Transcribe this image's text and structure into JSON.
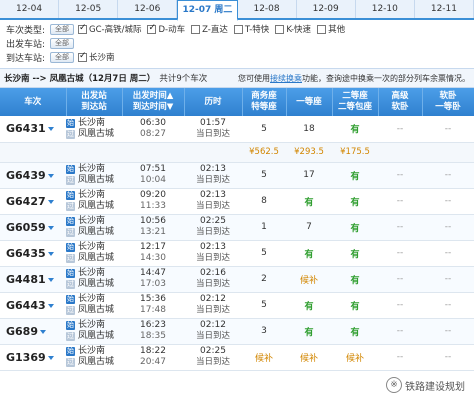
{
  "date_tabs": [
    {
      "label": "12-04",
      "active": false
    },
    {
      "label": "12-05",
      "active": false
    },
    {
      "label": "12-06",
      "active": false
    },
    {
      "label": "12-07 周二",
      "active": true
    },
    {
      "label": "12-08",
      "active": false
    },
    {
      "label": "12-09",
      "active": false
    },
    {
      "label": "12-10",
      "active": false
    },
    {
      "label": "12-11",
      "active": false
    }
  ],
  "filters": {
    "train_type_label": "车次类型:",
    "depart_station_label": "出发车站:",
    "arrive_station_label": "到达车站:",
    "all_label": "全部",
    "train_types": [
      {
        "label": "GC-高铁/城际",
        "checked": true
      },
      {
        "label": "D-动车",
        "checked": true
      },
      {
        "label": "Z-直达",
        "checked": false
      },
      {
        "label": "T-特快",
        "checked": false
      },
      {
        "label": "K-快速",
        "checked": false
      },
      {
        "label": "其他",
        "checked": false
      }
    ],
    "depart_stations": [
      {
        "label": "长沙南",
        "checked": true
      }
    ]
  },
  "summary": {
    "route": "长沙南 --> 凤凰古城（12月7日 周二）",
    "count": "共计9个车次",
    "tip_prefix": "您可使用",
    "tip_link": "接续换乘",
    "tip_suffix": "功能，查询途中换乘一次的部分列车余票情况。"
  },
  "table": {
    "headers": [
      "车次",
      "出发站\n到达站",
      "出发时间▲\n到达时间▼",
      "历时",
      "商务座\n特等座",
      "一等座",
      "二等座\n二等包座",
      "高级\n软卧",
      "软卧\n一等卧"
    ],
    "rows": [
      {
        "train": "G6431",
        "from": "长沙南",
        "to": "凤凰古城",
        "dep": "06:30",
        "arr": "08:27",
        "dur": "01:57",
        "dur_sub": "当日到达",
        "business": "5",
        "first": "18",
        "second": "有",
        "adv_soft": "--",
        "soft": "--",
        "price": {
          "business": "¥562.5",
          "first": "¥293.5",
          "second": "¥175.5"
        }
      },
      {
        "train": "G6439",
        "from": "长沙南",
        "to": "凤凰古城",
        "dep": "07:51",
        "arr": "10:04",
        "dur": "02:13",
        "dur_sub": "当日到达",
        "business": "5",
        "first": "17",
        "second": "有",
        "adv_soft": "--",
        "soft": "--"
      },
      {
        "train": "G6427",
        "from": "长沙南",
        "to": "凤凰古城",
        "dep": "09:20",
        "arr": "11:33",
        "dur": "02:13",
        "dur_sub": "当日到达",
        "business": "8",
        "first": "有",
        "second": "有",
        "adv_soft": "--",
        "soft": "--"
      },
      {
        "train": "G6059",
        "from": "长沙南",
        "to": "凤凰古城",
        "dep": "10:56",
        "arr": "13:21",
        "dur": "02:25",
        "dur_sub": "当日到达",
        "business": "1",
        "first": "7",
        "second": "有",
        "adv_soft": "--",
        "soft": "--"
      },
      {
        "train": "G6435",
        "from": "长沙南",
        "to": "凤凰古城",
        "dep": "12:17",
        "arr": "14:30",
        "dur": "02:13",
        "dur_sub": "当日到达",
        "business": "5",
        "first": "有",
        "second": "有",
        "adv_soft": "--",
        "soft": "--"
      },
      {
        "train": "G4481",
        "from": "长沙南",
        "to": "凤凰古城",
        "dep": "14:47",
        "arr": "17:03",
        "dur": "02:16",
        "dur_sub": "当日到达",
        "business": "2",
        "first": "候补",
        "second": "有",
        "adv_soft": "--",
        "soft": "--"
      },
      {
        "train": "G6443",
        "from": "长沙南",
        "to": "凤凰古城",
        "dep": "15:36",
        "arr": "17:48",
        "dur": "02:12",
        "dur_sub": "当日到达",
        "business": "5",
        "first": "有",
        "second": "有",
        "adv_soft": "--",
        "soft": "--"
      },
      {
        "train": "G689",
        "from": "长沙南",
        "to": "凤凰古城",
        "dep": "16:23",
        "arr": "18:35",
        "dur": "02:12",
        "dur_sub": "当日到达",
        "business": "3",
        "first": "有",
        "second": "有",
        "adv_soft": "--",
        "soft": "--"
      },
      {
        "train": "G1369",
        "from": "长沙南",
        "to": "凤凰古城",
        "dep": "18:22",
        "arr": "20:47",
        "dur": "02:25",
        "dur_sub": "当日到达",
        "business": "候补",
        "first": "候补",
        "second": "候补",
        "adv_soft": "--",
        "soft": "--"
      }
    ]
  },
  "badges": {
    "start": "始",
    "pass": "过"
  },
  "watermark": {
    "text": "铁路建设规划",
    "logo": "※"
  },
  "colors": {
    "header_blue": "#2f80cf",
    "available_green": "#2f9e2f",
    "waitlist_orange": "#d28600"
  }
}
